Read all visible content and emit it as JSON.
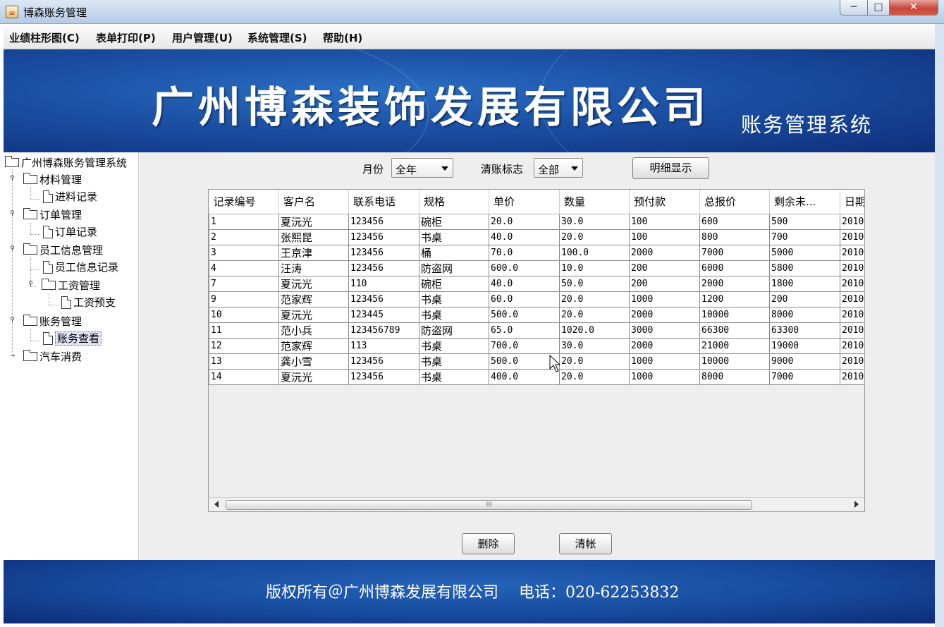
{
  "window": {
    "title": "博森账务管理",
    "min": "─",
    "max": "□",
    "close": "✕"
  },
  "menu": [
    "业绩柱形图(C)",
    "表单打印(P)",
    "用户管理(U)",
    "系统管理(S)",
    "帮助(H)"
  ],
  "banner": {
    "company": "广州博森装饰发展有限公司",
    "subtitle": "账务管理系统"
  },
  "tree": {
    "root": "广州博森账务管理系统",
    "nodes": [
      "材料管理",
      "进料记录",
      "订单管理",
      "订单记录",
      "员工信息管理",
      "员工信息记录",
      "工资管理",
      "工资预支",
      "账务管理",
      "账务查看",
      "汽车消费"
    ]
  },
  "filters": {
    "month_label": "月份",
    "month_value": "全年",
    "flag_label": "清账标志",
    "flag_value": "全部",
    "detail_button": "明细显示"
  },
  "table": {
    "columns": [
      "记录编号",
      "客户名",
      "联系电话",
      "规格",
      "单价",
      "数量",
      "预付款",
      "总报价",
      "剩余未...",
      "日期"
    ],
    "rows": [
      [
        "1",
        "夏沅光",
        "123456",
        "碗柜",
        "20.0",
        "30.0",
        "100",
        "600",
        "500",
        "2010"
      ],
      [
        "2",
        "张熙昆",
        "123456",
        "书桌",
        "40.0",
        "20.0",
        "100",
        "800",
        "700",
        "2010"
      ],
      [
        "3",
        "王京津",
        "123456",
        "桶",
        "70.0",
        "100.0",
        "2000",
        "7000",
        "5000",
        "2010"
      ],
      [
        "4",
        "汪涛",
        "123456",
        "防盗网",
        "600.0",
        "10.0",
        "200",
        "6000",
        "5800",
        "2010"
      ],
      [
        "7",
        "夏沅光",
        "110",
        "碗柜",
        "40.0",
        "50.0",
        "200",
        "2000",
        "1800",
        "2010"
      ],
      [
        "9",
        "范家辉",
        "123456",
        "书桌",
        "60.0",
        "20.0",
        "1000",
        "1200",
        "200",
        "2010"
      ],
      [
        "10",
        "夏沅光",
        "123445",
        "书桌",
        "500.0",
        "20.0",
        "2000",
        "10000",
        "8000",
        "2010"
      ],
      [
        "11",
        "范小兵",
        "123456789",
        "防盗网",
        "65.0",
        "1020.0",
        "3000",
        "66300",
        "63300",
        "2010"
      ],
      [
        "12",
        "范家辉",
        "113",
        "书桌",
        "700.0",
        "30.0",
        "2000",
        "21000",
        "19000",
        "2010"
      ],
      [
        "13",
        "龚小雪",
        "123456",
        "书桌",
        "500.0",
        "20.0",
        "1000",
        "10000",
        "9000",
        "2010"
      ],
      [
        "14",
        "夏沅光",
        "123456",
        "书桌",
        "400.0",
        "20.0",
        "1000",
        "8000",
        "7000",
        "2010"
      ]
    ]
  },
  "scroll_grip": "III",
  "actions": {
    "delete": "删除",
    "clear": "清帐"
  },
  "footer": {
    "copyright": "版权所有＠广州博森发展有限公司　 电话：020-62253832"
  }
}
